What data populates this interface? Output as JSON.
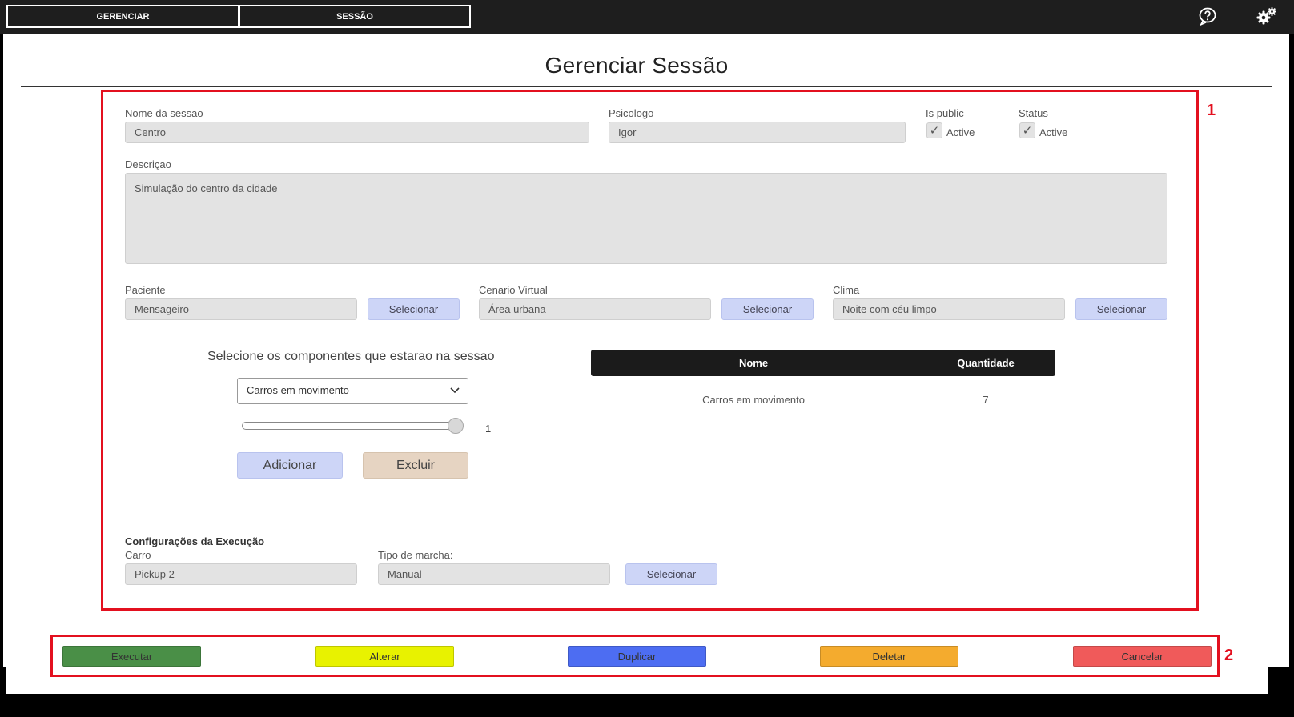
{
  "topbar": {
    "tabs": [
      {
        "label": "GERENCIAR"
      },
      {
        "label": "SESSÃO"
      }
    ],
    "icons": {
      "help": "help-icon",
      "settings": "gears-icon"
    }
  },
  "page": {
    "title": "Gerenciar Sessão"
  },
  "annotations": {
    "box1": "1",
    "box2": "2",
    "color": "#e3101f"
  },
  "form": {
    "nome_label": "Nome da sessao",
    "nome_value": "Centro",
    "psicologo_label": "Psicologo",
    "psicologo_value": "Igor",
    "is_public_label": "Is public",
    "is_public_check": "Active",
    "status_label": "Status",
    "status_check": "Active",
    "descricao_label": "Descriçao",
    "descricao_value": "Simulação do centro da cidade",
    "paciente_label": "Paciente",
    "paciente_value": "Mensageiro",
    "cenario_label": "Cenario Virtual",
    "cenario_value": "Área urbana",
    "clima_label": "Clima",
    "clima_value": "Noite com céu limpo",
    "selecionar_label": "Selecionar"
  },
  "components": {
    "heading": "Selecione os componentes que estarao na sessao",
    "dropdown_value": "Carros em movimento",
    "slider_value": "1",
    "add_label": "Adicionar",
    "remove_label": "Excluir",
    "table": {
      "headers": [
        "Nome",
        "Quantidade"
      ],
      "rows": [
        {
          "nome": "Carros em movimento",
          "quantidade": "7"
        }
      ]
    }
  },
  "execution": {
    "heading": "Configurações da Execução",
    "carro_label": "Carro",
    "carro_value": "Pickup 2",
    "marcha_label": "Tipo de marcha:",
    "marcha_value": "Manual",
    "selecionar_label": "Selecionar"
  },
  "actions": [
    {
      "label": "Executar",
      "color": "#4a8f47"
    },
    {
      "label": "Alterar",
      "color": "#e8f200"
    },
    {
      "label": "Duplicar",
      "color": "#4d6df2"
    },
    {
      "label": "Deletar",
      "color": "#f4ab2e"
    },
    {
      "label": "Cancelar",
      "color": "#f05a5a"
    }
  ]
}
